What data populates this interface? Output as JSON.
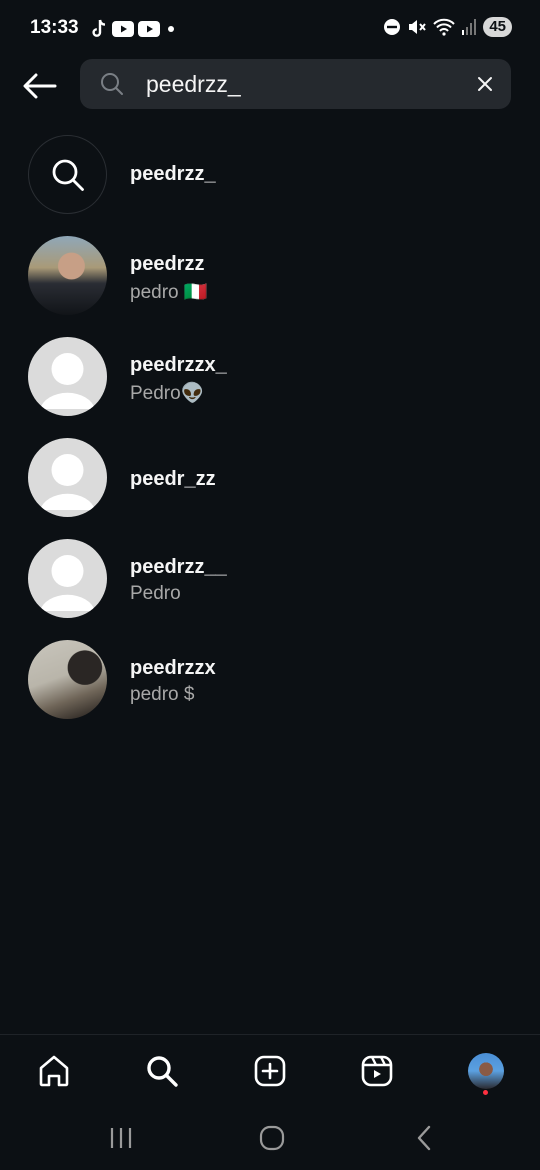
{
  "status_bar": {
    "time": "13:33",
    "battery": "45",
    "left_icons": [
      "tiktok-icon",
      "youtube-icon",
      "youtube-icon",
      "dot-icon"
    ],
    "right_icons": [
      "dnd-icon",
      "mute-icon",
      "wifi-icon",
      "signal-icon"
    ]
  },
  "search": {
    "query": "peedrzz_",
    "placeholder": "Search"
  },
  "results": [
    {
      "type": "query",
      "username": "peedrzz_",
      "subtitle": ""
    },
    {
      "type": "user",
      "username": "peedrzz",
      "subtitle": "pedro 🇮🇹",
      "avatar": "photo"
    },
    {
      "type": "user",
      "username": "peedrzzx_",
      "subtitle": "Pedro👽",
      "avatar": "default"
    },
    {
      "type": "user",
      "username": "peedr_zz",
      "subtitle": "",
      "avatar": "default"
    },
    {
      "type": "user",
      "username": "peedrzz__",
      "subtitle": "Pedro",
      "avatar": "default"
    },
    {
      "type": "user",
      "username": "peedrzzx",
      "subtitle": "pedro $",
      "avatar": "photo"
    }
  ],
  "bottom_nav": {
    "items": [
      "home-icon",
      "search-icon",
      "create-icon",
      "reels-icon",
      "profile-avatar"
    ],
    "active": "search-icon"
  },
  "colors": {
    "background": "#0c1014",
    "search_field": "#25292e",
    "text_primary": "#f5f5f5",
    "text_secondary": "#a8a8a8",
    "notification": "#ff3040"
  }
}
